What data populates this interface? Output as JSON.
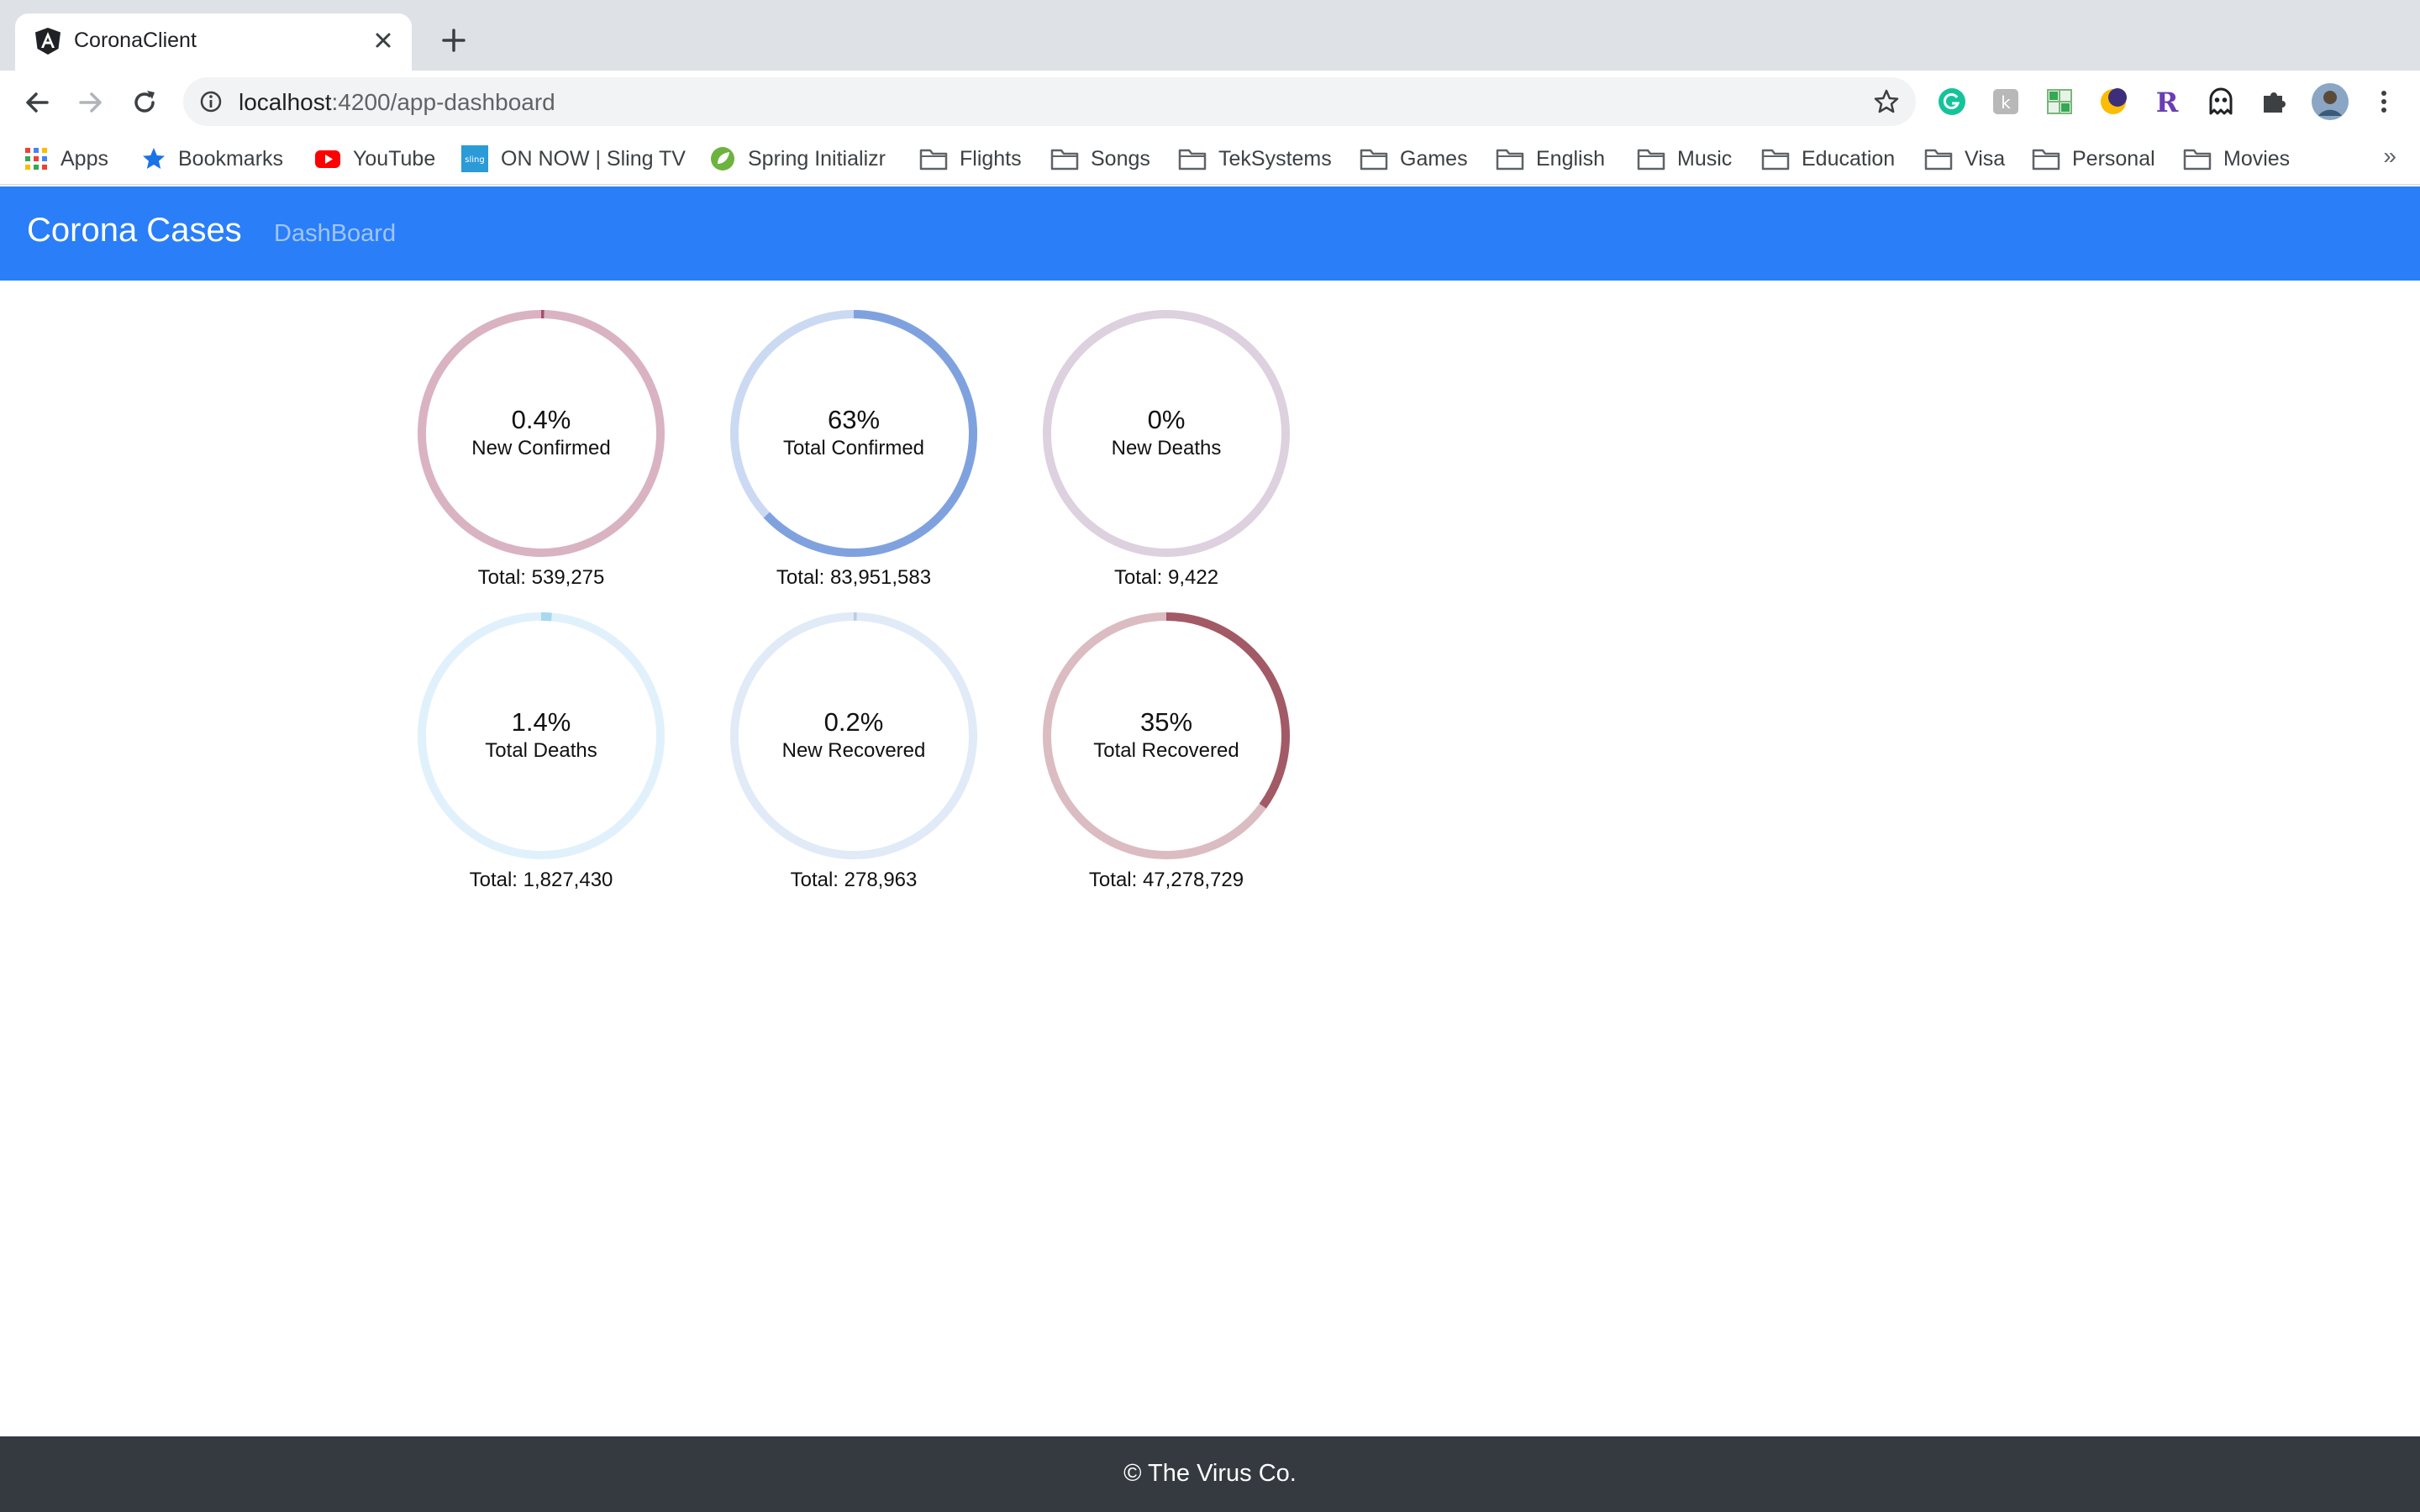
{
  "browser": {
    "tab_title": "CoronaClient",
    "url_host": "localhost",
    "url_path": ":4200/app-dashboard",
    "bookmarks": [
      {
        "label": "Apps",
        "icon": "apps-grid-icon"
      },
      {
        "label": "Bookmarks",
        "icon": "star-icon"
      },
      {
        "label": "YouTube",
        "icon": "youtube-icon"
      },
      {
        "label": "ON NOW | Sling TV",
        "icon": "sling-icon"
      },
      {
        "label": "Spring Initializr",
        "icon": "spring-icon"
      },
      {
        "label": "Flights",
        "icon": "folder-icon"
      },
      {
        "label": "Songs",
        "icon": "folder-icon"
      },
      {
        "label": "TekSystems",
        "icon": "folder-icon"
      },
      {
        "label": "Games",
        "icon": "folder-icon"
      },
      {
        "label": "English",
        "icon": "folder-icon"
      },
      {
        "label": "Music",
        "icon": "folder-icon"
      },
      {
        "label": "Education",
        "icon": "folder-icon"
      },
      {
        "label": "Visa",
        "icon": "folder-icon"
      },
      {
        "label": "Personal",
        "icon": "folder-icon"
      },
      {
        "label": "Movies",
        "icon": "folder-icon"
      }
    ],
    "more_bookmarks": "»"
  },
  "app": {
    "brand": "Corona Cases",
    "nav_link": "DashBoard",
    "footer": "© The Virus Co."
  },
  "chart_data": {
    "type": "donut-gauges",
    "gauges": [
      {
        "percent_label": "0.4%",
        "value": 0.4,
        "label": "New Confirmed",
        "total": "Total: 539,275",
        "track": "#d9b3c1",
        "fill": "#a84f6e"
      },
      {
        "percent_label": "63%",
        "value": 63,
        "label": "Total Confirmed",
        "total": "Total: 83,951,583",
        "track": "#cbdaf2",
        "fill": "#7fa2df"
      },
      {
        "percent_label": "0%",
        "value": 0,
        "label": "New Deaths",
        "total": "Total: 9,422",
        "track": "#ddd0df",
        "fill": "#a78bb0"
      },
      {
        "percent_label": "1.4%",
        "value": 1.4,
        "label": "Total Deaths",
        "total": "Total: 1,827,430",
        "track": "#e0f1fb",
        "fill": "#a8d8f0"
      },
      {
        "percent_label": "0.2%",
        "value": 0.2,
        "label": "New Recovered",
        "total": "Total: 278,963",
        "track": "#e1eaf7",
        "fill": "#b9cde8"
      },
      {
        "percent_label": "35%",
        "value": 35,
        "label": "Total Recovered",
        "total": "Total: 47,278,729",
        "track": "#dbbcc2",
        "fill": "#a25a66"
      }
    ]
  }
}
